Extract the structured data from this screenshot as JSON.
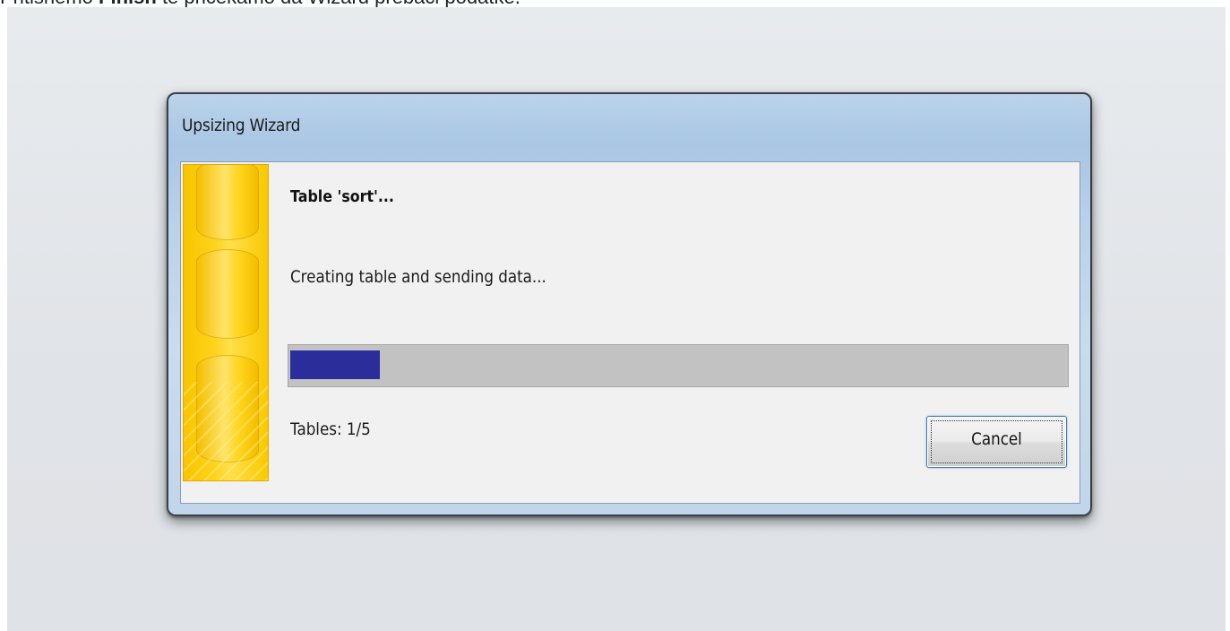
{
  "page_caption": {
    "prefix": "Pritisnemo ",
    "bold": "Finish",
    "suffix": " te pričekamo da Wizard prebaci podatke."
  },
  "dialog": {
    "title": "Upsizing  Wizard",
    "heading": "Table 'sort'...",
    "status": "Creating table and sending data...",
    "progress": 0.115,
    "tables_count": "Tables: 1/5",
    "cancel_label": "Cancel"
  },
  "colors": {
    "progress_fill": "#2b2d9a",
    "progress_track": "#c2c2c2",
    "banner": "#ffd21a"
  },
  "icons": {
    "banner": "database-cylinders-icon"
  }
}
